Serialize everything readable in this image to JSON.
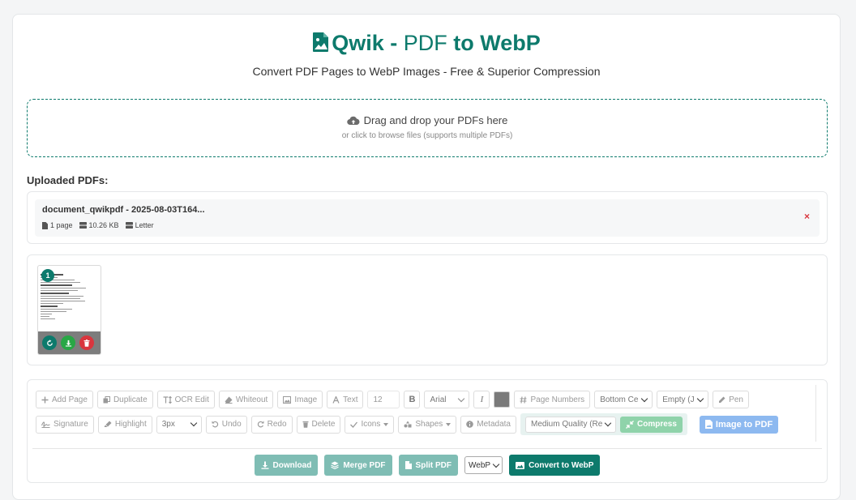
{
  "header": {
    "brand": "Qwik",
    "dash": " - ",
    "pdf": "PDF",
    "to_webp": " to WebP",
    "subtitle": "Convert PDF Pages to WebP Images - Free & Superior Compression"
  },
  "dropzone": {
    "main_text": "Drag and drop your PDFs here",
    "sub_text": "or click to browse files (supports multiple PDFs)"
  },
  "uploaded": {
    "heading": "Uploaded PDFs:",
    "files": [
      {
        "name": "document_qwikpdf - 2025-08-03T164...",
        "pages": "1 page",
        "size": "10.26 KB",
        "format": "Letter",
        "remove": "×"
      }
    ]
  },
  "pages": [
    {
      "number": "1"
    }
  ],
  "toolbar": {
    "row1": {
      "add_page": "Add Page",
      "duplicate": "Duplicate",
      "ocr_edit": "OCR Edit",
      "whiteout": "Whiteout",
      "image": "Image",
      "text": "Text",
      "font_size": "12",
      "bold": "B",
      "font": "Arial",
      "italic": "I",
      "page_numbers": "Page Numbers",
      "position": "Bottom Ce",
      "format": "Empty (J",
      "pen": "Pen"
    },
    "row2": {
      "signature": "Signature",
      "highlight": "Highlight",
      "stroke": "3px",
      "undo": "Undo",
      "redo": "Redo",
      "delete": "Delete",
      "icons": "Icons",
      "shapes": "Shapes",
      "metadata": "Metadata",
      "quality": "Medium Quality (Re",
      "compress": "Compress",
      "image_to_pdf": "Image to PDF"
    }
  },
  "actions": {
    "download": "Download",
    "merge": "Merge PDF",
    "split": "Split PDF",
    "format": "WebP",
    "convert": "Convert to WebP"
  },
  "colors": {
    "brand": "#0d7a6c",
    "danger": "#d9363e",
    "success": "#28a745",
    "swatch": "#7a7a7a"
  }
}
